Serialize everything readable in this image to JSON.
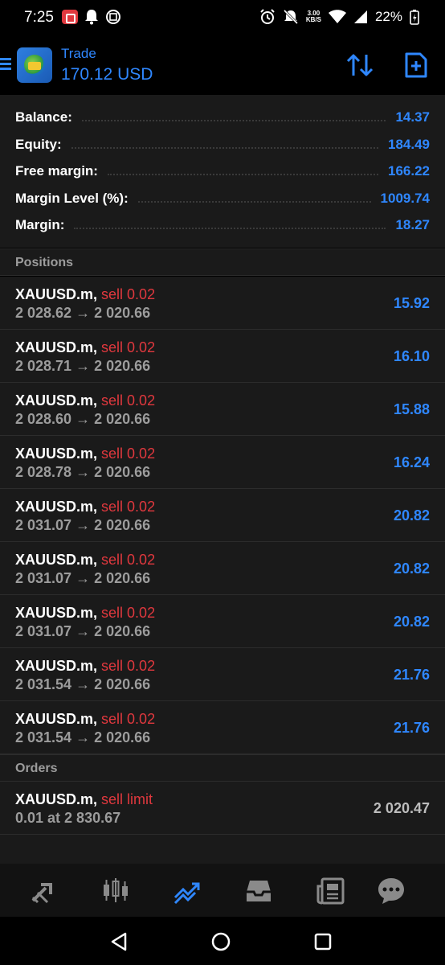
{
  "status_bar": {
    "time": "7:25",
    "net_speed_value": "3.00",
    "net_speed_unit": "KB/S",
    "battery": "22%"
  },
  "header": {
    "title": "Trade",
    "balance": "170.12 USD",
    "accent_color": "#2f87ff"
  },
  "account": {
    "balance_label": "Balance:",
    "balance": "14.37",
    "equity_label": "Equity:",
    "equity": "184.49",
    "free_margin_label": "Free margin:",
    "free_margin": "166.22",
    "margin_level_label": "Margin Level (%):",
    "margin_level": "1009.74",
    "margin_label": "Margin:",
    "margin": "18.27"
  },
  "positions_header": "Positions",
  "positions": [
    {
      "symbol": "XAUUSD.m,",
      "side": "sell 0.02",
      "prices": "2 028.62 → 2 020.66",
      "profit": "15.92"
    },
    {
      "symbol": "XAUUSD.m,",
      "side": "sell 0.02",
      "prices": "2 028.71 → 2 020.66",
      "profit": "16.10"
    },
    {
      "symbol": "XAUUSD.m,",
      "side": "sell 0.02",
      "prices": "2 028.60 → 2 020.66",
      "profit": "15.88"
    },
    {
      "symbol": "XAUUSD.m,",
      "side": "sell 0.02",
      "prices": "2 028.78 → 2 020.66",
      "profit": "16.24"
    },
    {
      "symbol": "XAUUSD.m,",
      "side": "sell 0.02",
      "prices": "2 031.07 → 2 020.66",
      "profit": "20.82"
    },
    {
      "symbol": "XAUUSD.m,",
      "side": "sell 0.02",
      "prices": "2 031.07 → 2 020.66",
      "profit": "20.82"
    },
    {
      "symbol": "XAUUSD.m,",
      "side": "sell 0.02",
      "prices": "2 031.07 → 2 020.66",
      "profit": "20.82"
    },
    {
      "symbol": "XAUUSD.m,",
      "side": "sell 0.02",
      "prices": "2 031.54 → 2 020.66",
      "profit": "21.76"
    },
    {
      "symbol": "XAUUSD.m,",
      "side": "sell 0.02",
      "prices": "2 031.54 → 2 020.66",
      "profit": "21.76"
    }
  ],
  "orders_header": "Orders",
  "orders": [
    {
      "symbol": "XAUUSD.m,",
      "side": "sell limit",
      "detail": "0.01 at 2 830.67",
      "price": "2 020.47"
    }
  ],
  "bottom_nav": [
    "quotes-icon",
    "chart-icon",
    "trade-icon",
    "history-icon",
    "news-icon",
    "chat-icon"
  ],
  "colors": {
    "sell": "#e0383e",
    "profit": "#2f87ff",
    "active_tab": "#2f87ff"
  }
}
